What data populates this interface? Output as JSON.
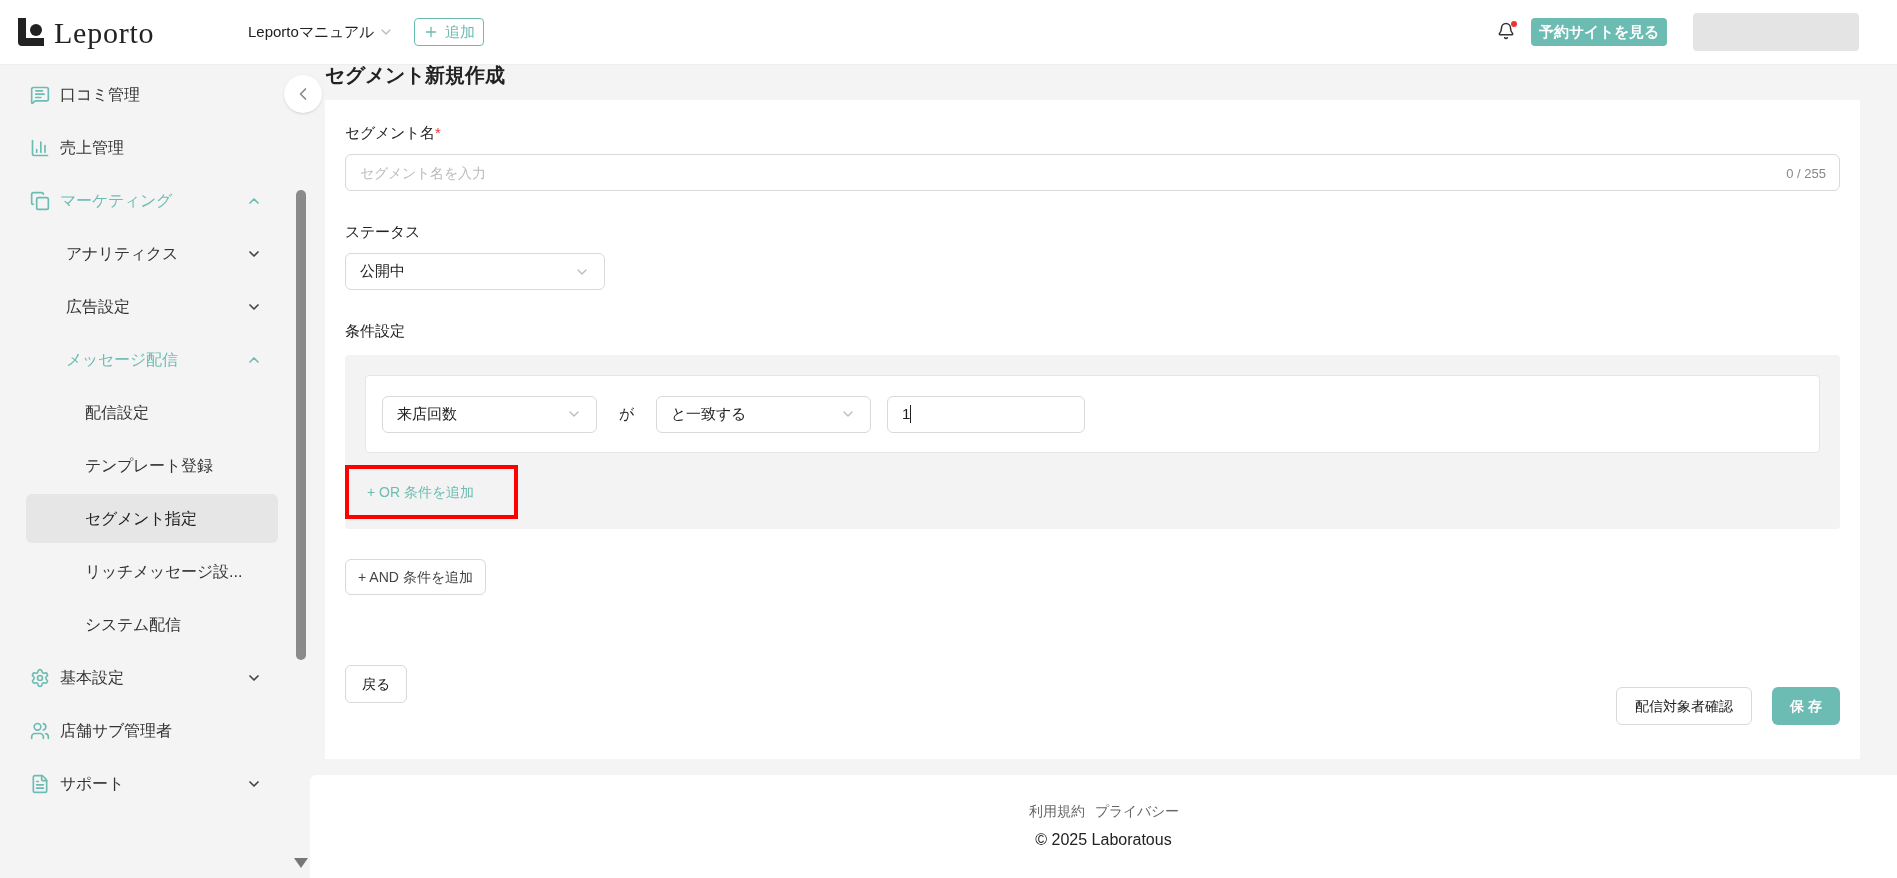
{
  "header": {
    "logo": "Leporto",
    "workspace": "Leportoマニュアル",
    "add_button": "追加",
    "notification_unread": true,
    "site_button": "予約サイトを見る"
  },
  "sidebar": {
    "items": [
      {
        "label": "口コミ管理"
      },
      {
        "label": "売上管理"
      },
      {
        "label": "マーケティング",
        "expanded": true,
        "children": [
          {
            "label": "アナリティクス",
            "expanded": false
          },
          {
            "label": "広告設定",
            "expanded": false
          },
          {
            "label": "メッセージ配信",
            "expanded": true,
            "children": [
              {
                "label": "配信設定",
                "selected": false
              },
              {
                "label": "テンプレート登録",
                "selected": false
              },
              {
                "label": "セグメント指定",
                "selected": true
              },
              {
                "label": "リッチメッセージ設...",
                "selected": false
              },
              {
                "label": "システム配信",
                "selected": false
              }
            ]
          }
        ]
      },
      {
        "label": "基本設定",
        "expanded": false
      },
      {
        "label": "店舗サブ管理者"
      },
      {
        "label": "サポート",
        "expanded": false
      }
    ]
  },
  "page_title": "セグメント新規作成",
  "form": {
    "name_label": "セグメント名",
    "required_mark": "*",
    "name_placeholder": "セグメント名を入力",
    "name_counter": "0 / 255",
    "status_label": "ステータス",
    "status_value": "公開中",
    "conditions_label": "条件設定",
    "conditions": [
      {
        "field": "来店回数",
        "joiner": "が",
        "operator": "と一致する",
        "value": "1"
      }
    ],
    "or_button": "+ OR 条件を追加",
    "or_button_highlighted": true,
    "and_button": "+ AND 条件を追加",
    "back_button": "戻る",
    "preview_button": "配信対象者確認",
    "save_button": "保 存"
  },
  "footer": {
    "links": [
      "利用規約",
      "プライバシー"
    ],
    "copyright": "© 2025 Laboratous"
  }
}
